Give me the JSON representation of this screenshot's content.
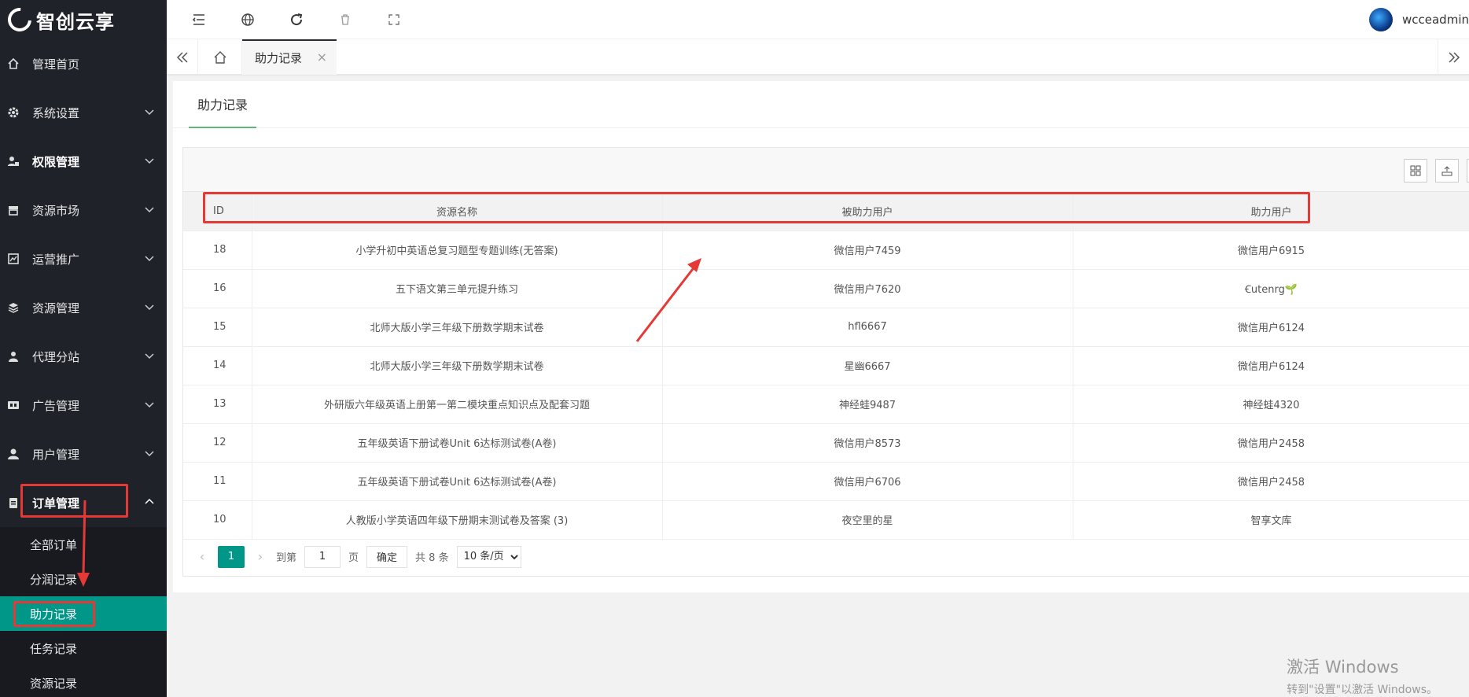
{
  "brand": {
    "name": "智创云享"
  },
  "sidebar": {
    "items": [
      {
        "label": "管理首页",
        "icon": "home-icon",
        "has_chevron": false,
        "bold": false
      },
      {
        "label": "系统设置",
        "icon": "gear-icon",
        "has_chevron": true,
        "bold": false
      },
      {
        "label": "权限管理",
        "icon": "user-lock-icon",
        "has_chevron": true,
        "bold": true
      },
      {
        "label": "资源市场",
        "icon": "store-icon",
        "has_chevron": true,
        "bold": false
      },
      {
        "label": "运营推广",
        "icon": "chart-icon",
        "has_chevron": true,
        "bold": false
      },
      {
        "label": "资源管理",
        "icon": "layers-icon",
        "has_chevron": true,
        "bold": false
      },
      {
        "label": "代理分站",
        "icon": "agent-icon",
        "has_chevron": true,
        "bold": false
      },
      {
        "label": "广告管理",
        "icon": "ad-icon",
        "has_chevron": true,
        "bold": false
      },
      {
        "label": "用户管理",
        "icon": "user-icon",
        "has_chevron": true,
        "bold": false
      },
      {
        "label": "订单管理",
        "icon": "clipboard-icon",
        "has_chevron": true,
        "bold": true,
        "expanded": true
      }
    ],
    "submenu": [
      "全部订单",
      "分润记录",
      "助力记录",
      "任务记录",
      "资源记录"
    ],
    "active_submenu": "助力记录"
  },
  "header": {
    "icons": [
      "menu-fold-icon",
      "globe-icon",
      "refresh-icon",
      "trash-icon",
      "fullscreen-icon"
    ],
    "user_name": "wcceadmin"
  },
  "tabbar": {
    "active_tab": "助力记录",
    "close_glyph": "×"
  },
  "card": {
    "tab_label": "助力记录"
  },
  "table": {
    "columns": [
      "ID",
      "资源名称",
      "被助力用户",
      "助力用户"
    ],
    "rows": [
      [
        "18",
        "小学升初中英语总复习题型专题训练(无答案)",
        "微信用户7459",
        "微信用户6915"
      ],
      [
        "16",
        "五下语文第三单元提升练习",
        "微信用户7620",
        "Ꞓutenrg🌱"
      ],
      [
        "15",
        "北师大版小学三年级下册数学期末试卷",
        "hfl6667",
        "微信用户6124"
      ],
      [
        "14",
        "北师大版小学三年级下册数学期末试卷",
        "星幽6667",
        "微信用户6124"
      ],
      [
        "13",
        "外研版六年级英语上册第一第二模块重点知识点及配套习题",
        "神经蛙9487",
        "神经蛙4320"
      ],
      [
        "12",
        "五年级英语下册试卷Unit 6达标测试卷(A卷)",
        "微信用户8573",
        "微信用户2458"
      ],
      [
        "11",
        "五年级英语下册试卷Unit 6达标测试卷(A卷)",
        "微信用户6706",
        "微信用户2458"
      ],
      [
        "10",
        "人教版小学英语四年级下册期末测试卷及答案 (3)",
        "夜空里的星",
        "智享文库"
      ]
    ]
  },
  "pager": {
    "current_page": "1",
    "goto_label": "到第",
    "page_label": "页",
    "confirm_label": "确定",
    "total_label": "共 8 条",
    "page_size": "10 条/页",
    "input_value": "1"
  },
  "watermark": {
    "line1": "激活 Windows",
    "line2": "转到\"设置\"以激活 Windows。"
  },
  "colors": {
    "sidebar_bg": "#20222a",
    "active_green": "#009688",
    "annotation_red": "#e53935"
  }
}
